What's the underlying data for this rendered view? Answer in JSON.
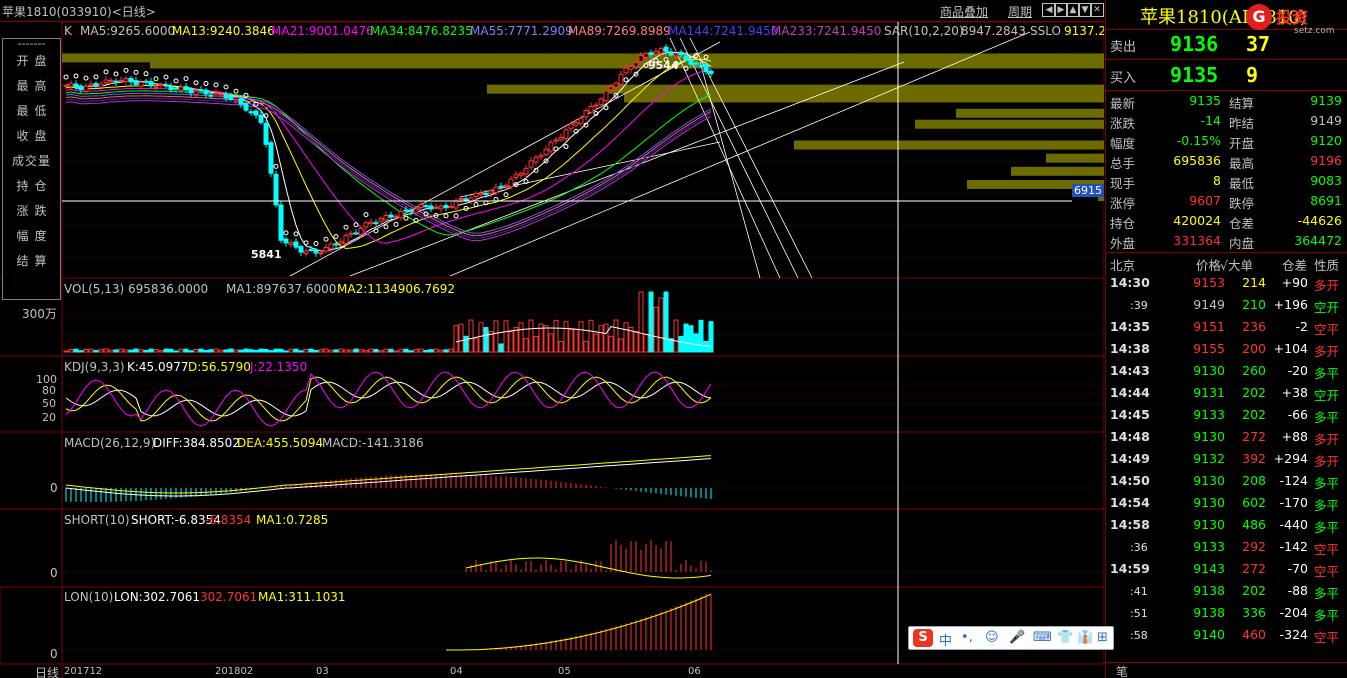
{
  "titlebar": {
    "title": "苹果1810(033910)<日线>",
    "overlay_link": "商品叠加",
    "period_link": "周期"
  },
  "nav_buttons": [
    "◀",
    "▶",
    "▲",
    "▼",
    "✕"
  ],
  "main_indicators": {
    "k": "K",
    "ma5": "MA5:9265.6000",
    "ma13": "MA13:9240.3846",
    "ma21": "MA21:9001.0476",
    "ma34": "MA34:8476.8235",
    "ma55": "MA55:7771.2909",
    "ma89": "MA89:7269.8989",
    "ma144": "MA144:7241.9450",
    "ma233": "MA233:7241.9450",
    "sar": "SAR(10,2,20)",
    "sar_val": "8947.2843",
    "sslo": "SSLO",
    "sslo_val": "9137.2"
  },
  "info_panel": {
    "dash": "-------",
    "rows": [
      "开盘",
      "最高",
      "最低",
      "收盘",
      "成交量",
      "持仓",
      "涨跌",
      "幅度",
      "结算"
    ]
  },
  "price_labels": {
    "high": "9544",
    "low": "5841",
    "cursor_value": "6915"
  },
  "vol_panel": {
    "label": "VOL(5,13) 695836.0000",
    "ma1": "MA1:897637.6000",
    "ma2": "MA2:1134906.7692",
    "axis": "300万"
  },
  "kdj_panel": {
    "label": "KDJ(9,3,3)",
    "k": "K:45.0977",
    "d": "D:56.5790",
    "j": "J:22.1350",
    "axis": [
      "100",
      "80",
      "50",
      "20"
    ]
  },
  "macd_panel": {
    "label": "MACD(26,12,9)",
    "diff": "DIFF:384.8502",
    "dea": "DEA:455.5094",
    "macd": "MACD:-141.3186",
    "axis0": "0"
  },
  "short_panel": {
    "label": "SHORT(10)",
    "short": "SHORT:-6.8354",
    "val": "-6.8354",
    "ma1": "MA1:0.7285",
    "axis0": "0"
  },
  "lon_panel": {
    "label": "LON(10)",
    "lon": "LON:302.7061",
    "val": "302.7061",
    "ma1": "MA1:311.1031",
    "axis0": "0"
  },
  "xaxis": {
    "corner": "日线",
    "labels": [
      "201712",
      "201802",
      "03",
      "04",
      "05",
      "06"
    ]
  },
  "colors": {
    "up": "#ff3232",
    "down": "#00ffff",
    "green": "#00ff00",
    "yellow": "#ffff00",
    "magenta": "#ff00ff",
    "grid": "#800000",
    "volume_band": "#6b6b00"
  },
  "sidebar": {
    "name": "苹果1810(AP1810)",
    "logo": {
      "mark": "G",
      "text": "投资",
      "url": "setz.com"
    },
    "sell": {
      "label": "卖出",
      "price": "9136",
      "vol": "37"
    },
    "buy": {
      "label": "买入",
      "price": "9135",
      "vol": "9"
    },
    "stats": [
      {
        "k1": "最新",
        "v1": "9135",
        "c1": "#00ff00",
        "k2": "结算",
        "v2": "9139",
        "c2": "#00ff00"
      },
      {
        "k1": "涨跌",
        "v1": "-14",
        "c1": "#00ff00",
        "k2": "昨结",
        "v2": "9149",
        "c2": "#c0c0c0"
      },
      {
        "k1": "幅度",
        "v1": "-0.15%",
        "c1": "#00ff00",
        "k2": "开盘",
        "v2": "9120",
        "c2": "#00ff00"
      },
      {
        "k1": "总手",
        "v1": "695836",
        "c1": "#ffff00",
        "k2": "最高",
        "v2": "9196",
        "c2": "#ff3232"
      },
      {
        "k1": "现手",
        "v1": "8",
        "c1": "#ffff00",
        "k2": "最低",
        "v2": "9083",
        "c2": "#00ff00"
      },
      {
        "k1": "涨停",
        "v1": "9607",
        "c1": "#ff3232",
        "k2": "跌停",
        "v2": "8691",
        "c2": "#00ff00"
      },
      {
        "k1": "持仓",
        "v1": "420024",
        "c1": "#ffff00",
        "k2": "仓差",
        "v2": "-44626",
        "c2": "#ffff00"
      },
      {
        "k1": "外盘",
        "v1": "331364",
        "c1": "#ff3232",
        "k2": "内盘",
        "v2": "364472",
        "c2": "#00ff00"
      }
    ],
    "tick_head": {
      "city": "北京",
      "price": "价格",
      "vol": "√大单",
      "diff": "仓差",
      "nature": "性质"
    },
    "ticks": [
      {
        "time": "14:30",
        "sub": false,
        "price": "9153",
        "pc": "#ff3232",
        "vol": "214",
        "vc": "#ffff00",
        "diff": "+90",
        "nature": "多开",
        "nc": "#ff3232"
      },
      {
        "time": ":39",
        "sub": true,
        "price": "9149",
        "pc": "#c0c0c0",
        "vol": "210",
        "vc": "#00ff00",
        "diff": "+196",
        "nature": "空开",
        "nc": "#00ff00"
      },
      {
        "time": "14:35",
        "sub": false,
        "price": "9151",
        "pc": "#ff3232",
        "vol": "236",
        "vc": "#ff3232",
        "diff": "-2",
        "nature": "空平",
        "nc": "#ff3232"
      },
      {
        "time": "14:38",
        "sub": false,
        "price": "9155",
        "pc": "#ff3232",
        "vol": "200",
        "vc": "#ff3232",
        "diff": "+104",
        "nature": "多开",
        "nc": "#ff3232"
      },
      {
        "time": "14:43",
        "sub": false,
        "price": "9130",
        "pc": "#00ff00",
        "vol": "260",
        "vc": "#00ff00",
        "diff": "-20",
        "nature": "多平",
        "nc": "#00ff00"
      },
      {
        "time": "14:44",
        "sub": false,
        "price": "9131",
        "pc": "#00ff00",
        "vol": "202",
        "vc": "#00ff00",
        "diff": "+38",
        "nature": "空开",
        "nc": "#00ff00"
      },
      {
        "time": "14:45",
        "sub": false,
        "price": "9133",
        "pc": "#00ff00",
        "vol": "202",
        "vc": "#00ff00",
        "diff": "-66",
        "nature": "多平",
        "nc": "#00ff00"
      },
      {
        "time": "14:48",
        "sub": false,
        "price": "9130",
        "pc": "#00ff00",
        "vol": "272",
        "vc": "#ff3232",
        "diff": "+88",
        "nature": "多开",
        "nc": "#ff3232"
      },
      {
        "time": "14:49",
        "sub": false,
        "price": "9132",
        "pc": "#00ff00",
        "vol": "392",
        "vc": "#ff3232",
        "diff": "+294",
        "nature": "多开",
        "nc": "#ff3232"
      },
      {
        "time": "14:50",
        "sub": false,
        "price": "9130",
        "pc": "#00ff00",
        "vol": "208",
        "vc": "#00ff00",
        "diff": "-124",
        "nature": "多平",
        "nc": "#00ff00"
      },
      {
        "time": "14:54",
        "sub": false,
        "price": "9130",
        "pc": "#00ff00",
        "vol": "602",
        "vc": "#00ff00",
        "diff": "-170",
        "nature": "多平",
        "nc": "#00ff00"
      },
      {
        "time": "14:58",
        "sub": false,
        "price": "9130",
        "pc": "#00ff00",
        "vol": "486",
        "vc": "#00ff00",
        "diff": "-440",
        "nature": "多平",
        "nc": "#00ff00"
      },
      {
        "time": ":36",
        "sub": true,
        "price": "9133",
        "pc": "#00ff00",
        "vol": "292",
        "vc": "#ff3232",
        "diff": "-142",
        "nature": "空平",
        "nc": "#ff3232"
      },
      {
        "time": "14:59",
        "sub": false,
        "price": "9143",
        "pc": "#00ff00",
        "vol": "272",
        "vc": "#ff3232",
        "diff": "-70",
        "nature": "空平",
        "nc": "#ff3232"
      },
      {
        "time": ":41",
        "sub": true,
        "price": "9138",
        "pc": "#00ff00",
        "vol": "202",
        "vc": "#00ff00",
        "diff": "-88",
        "nature": "多平",
        "nc": "#00ff00"
      },
      {
        "time": ":51",
        "sub": true,
        "price": "9138",
        "pc": "#00ff00",
        "vol": "336",
        "vc": "#00ff00",
        "diff": "-204",
        "nature": "多平",
        "nc": "#00ff00"
      },
      {
        "time": ":58",
        "sub": true,
        "price": "9140",
        "pc": "#00ff00",
        "vol": "460",
        "vc": "#ff3232",
        "diff": "-324",
        "nature": "空平",
        "nc": "#ff3232"
      }
    ],
    "footer": "笔"
  },
  "ime": {
    "s": "S",
    "items": [
      "中",
      "•,",
      "☺",
      "🎤",
      "⌨",
      "👕",
      "👔",
      "⊞"
    ]
  },
  "chart_data": {
    "type": "line",
    "title": "苹果1810(033910)<日线>",
    "x": [
      "201712",
      "201802",
      "03",
      "04",
      "05",
      "06"
    ],
    "close_series": [
      8900,
      8850,
      8950,
      9000,
      8950,
      8900,
      8850,
      8800,
      8750,
      8700,
      8500,
      8200,
      6100,
      5900,
      5841,
      6000,
      6200,
      6400,
      6500,
      6600,
      6700,
      6650,
      6800,
      6900,
      7000,
      7200,
      7500,
      7800,
      8100,
      8400,
      8700,
      9100,
      9400,
      9544,
      9480,
      9300,
      9135
    ],
    "series": [
      {
        "name": "MA5",
        "value": 9265.6
      },
      {
        "name": "MA13",
        "value": 9240.3846
      },
      {
        "name": "MA21",
        "value": 9001.0476
      },
      {
        "name": "MA34",
        "value": 8476.8235
      },
      {
        "name": "MA55",
        "value": 7771.2909
      },
      {
        "name": "MA89",
        "value": 7269.8989
      },
      {
        "name": "MA144",
        "value": 7241.945
      },
      {
        "name": "MA233",
        "value": 7241.945
      }
    ],
    "ylim": [
      5600,
      9800
    ],
    "high": 9544,
    "low": 5841,
    "grid": true
  }
}
